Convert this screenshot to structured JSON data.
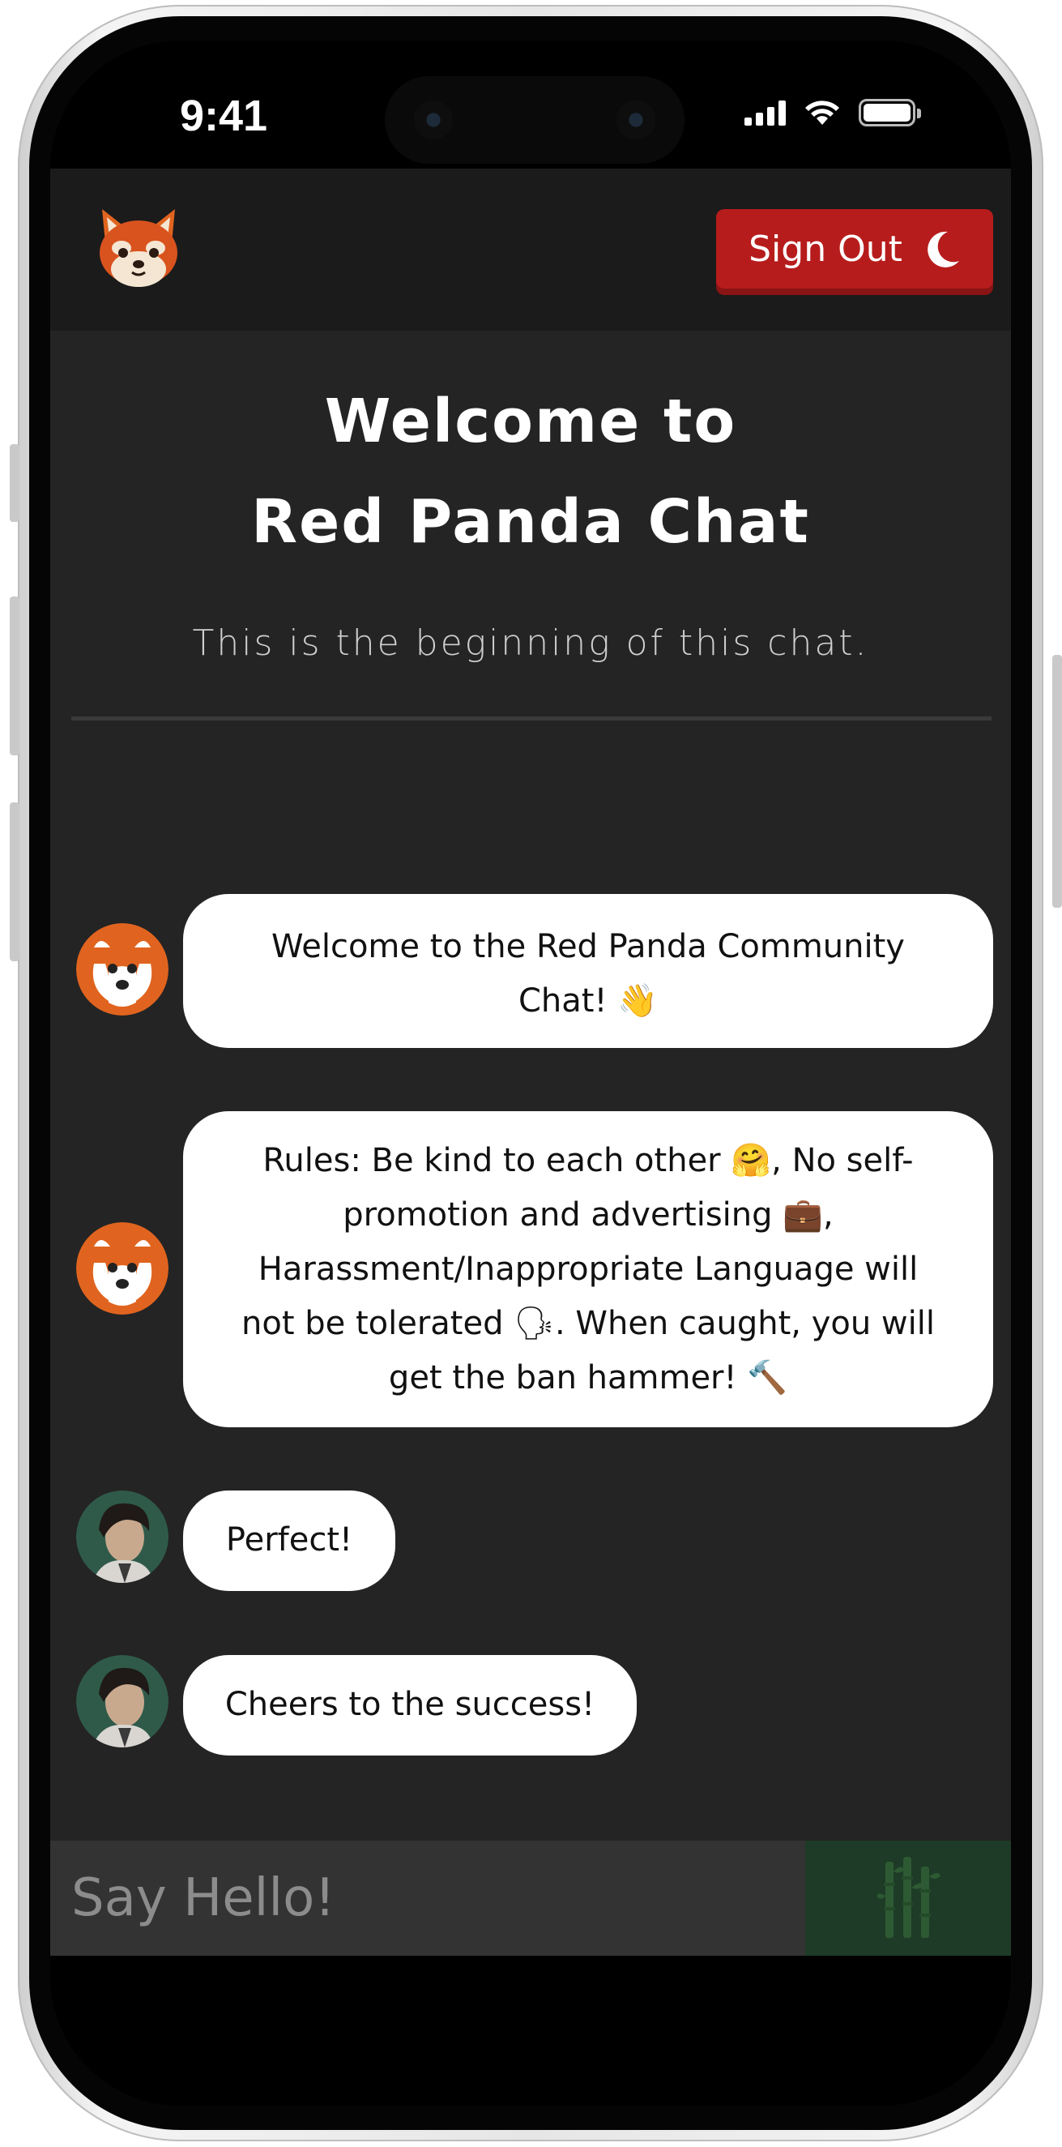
{
  "status_bar": {
    "time": "9:41"
  },
  "header": {
    "signout_label": "Sign Out"
  },
  "welcome": {
    "title_line1": "Welcome to",
    "title_line2": "Red Panda Chat",
    "subtitle": "This is the beginning of this chat."
  },
  "messages": [
    {
      "sender": "red-panda-bot",
      "lines": [
        "Welcome to the Red Panda Community",
        "Chat! 👋"
      ]
    },
    {
      "sender": "red-panda-bot",
      "lines": [
        "Rules: Be kind to each other 🤗, No self-",
        "promotion and advertising 💼,",
        "Harassment/Inappropriate Language will",
        "not be tolerated 🗣. When caught, you will",
        "get the ban hammer! 🔨"
      ]
    },
    {
      "sender": "user",
      "lines": [
        "Perfect!"
      ]
    },
    {
      "sender": "user",
      "lines": [
        "Cheers to the success!"
      ]
    }
  ],
  "composer": {
    "placeholder": "Say Hello!"
  },
  "colors": {
    "signout": "#b71c1c",
    "app_bg": "#242424",
    "send_bg": "#1d3b26",
    "avatar_orange": "#e0641f"
  },
  "icons": {
    "signout": "moon-icon",
    "send": "bamboo-icon",
    "logo": "red-panda-logo"
  }
}
